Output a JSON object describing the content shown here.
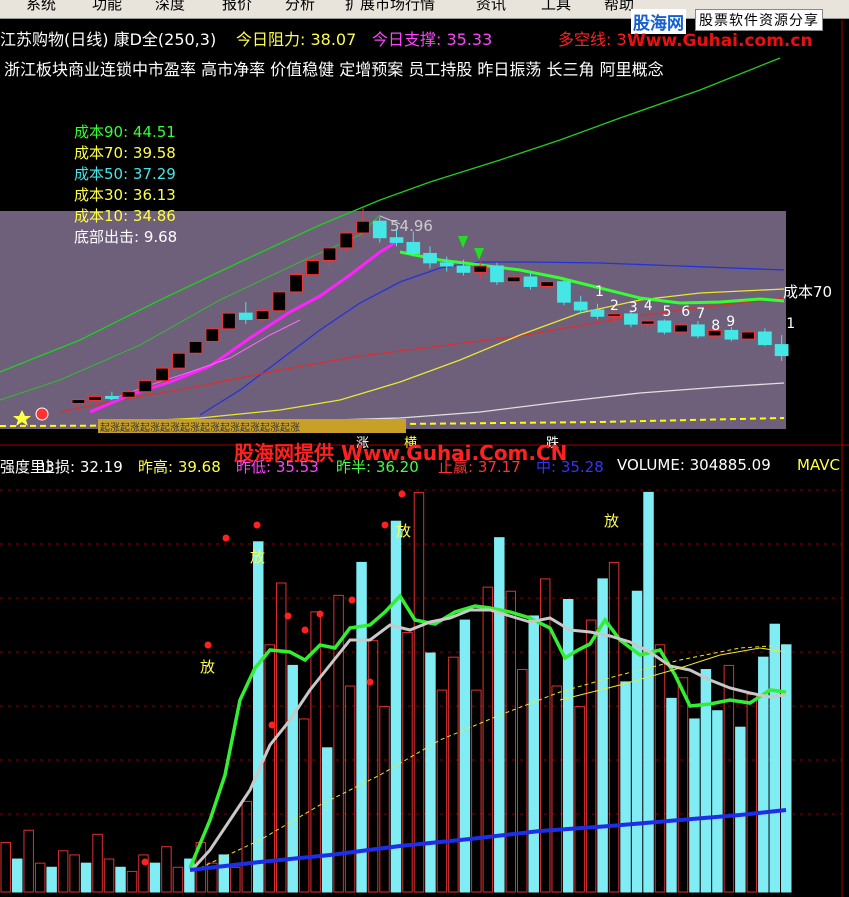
{
  "menu": [
    "系统",
    "功能",
    "深度",
    "报价",
    "分析",
    "扩展市场行情",
    "资讯",
    "工具",
    "帮助"
  ],
  "watermark": {
    "brand": "股海网",
    "tag": "股票软件资源分享",
    "url": "Www.Guhai.com.cn",
    "center": "股海网提供 Www.Guhai.Com.CN"
  },
  "title": {
    "name": "江苏购物(日线) 康D全(250,3)",
    "resistance": "今日阻力: 38.07",
    "support": "今日支撑: 35.33",
    "trend": "多空线: 3"
  },
  "concepts": "浙江板块商业连锁中市盈率 高市净率 价值稳健 定增预案 员工持股 昨日振荡 长三角 阿里概念",
  "cost_labels": [
    {
      "text": "成本90: 44.51",
      "color": "#33ff33"
    },
    {
      "text": "成本70: 39.58",
      "color": "#ffff44"
    },
    {
      "text": "成本50: 37.29",
      "color": "#44e6e6"
    },
    {
      "text": "成本30: 36.13",
      "color": "#ffff44"
    },
    {
      "text": "成本10: 34.86",
      "color": "#ffff44"
    },
    {
      "text": "底部出击: 9.68",
      "color": "#ffffff"
    }
  ],
  "upper_annotations": {
    "peak": "54.96",
    "cost70": "成本70",
    "numbers": [
      "1",
      "2",
      "3",
      "4",
      "5",
      "6",
      "7",
      "8",
      "9",
      "1"
    ],
    "volume_band": "起涨起涨起涨起涨起涨起涨起涨起涨起涨起涨",
    "bottom_marks": [
      "涨",
      "横",
      "跌"
    ]
  },
  "lower_header": [
    {
      "text": "强度里3",
      "color": "#ffffff"
    },
    {
      "text": "止损: 32.19",
      "color": "#ffffff"
    },
    {
      "text": "昨高: 39.68",
      "color": "#ffff44"
    },
    {
      "text": "昨低: 35.53",
      "color": "#ff44ff"
    },
    {
      "text": "昨半: 36.20",
      "color": "#44ff44"
    },
    {
      "text": "止赢: 37.17",
      "color": "#ff3333"
    },
    {
      "text": "中: 35.28",
      "color": "#3333ff"
    },
    {
      "text": "VOLUME: 304885.09",
      "color": "#ffffff"
    },
    {
      "text": "MAVC",
      "color": "#ffff44"
    }
  ],
  "fang_label": "放",
  "chart_data": [
    {
      "type": "candlestick",
      "title": "江苏购物(日线) 康D全(250,3)",
      "ylim": [
        0,
        60
      ],
      "candles": [
        {
          "o": 30.1,
          "h": 30.7,
          "l": 29.9,
          "c": 30.6
        },
        {
          "o": 30.5,
          "h": 31.2,
          "l": 30.3,
          "c": 31.0
        },
        {
          "o": 31.0,
          "h": 31.6,
          "l": 30.7,
          "c": 30.9
        },
        {
          "o": 30.9,
          "h": 31.8,
          "l": 30.8,
          "c": 31.6
        },
        {
          "o": 31.6,
          "h": 33.2,
          "l": 31.5,
          "c": 33.0
        },
        {
          "o": 33.0,
          "h": 34.9,
          "l": 32.9,
          "c": 34.6
        },
        {
          "o": 34.6,
          "h": 36.8,
          "l": 34.5,
          "c": 36.5
        },
        {
          "o": 36.5,
          "h": 38.2,
          "l": 36.3,
          "c": 38.0
        },
        {
          "o": 38.0,
          "h": 39.8,
          "l": 37.9,
          "c": 39.6
        },
        {
          "o": 39.6,
          "h": 41.8,
          "l": 39.5,
          "c": 41.6
        },
        {
          "o": 41.6,
          "h": 43.0,
          "l": 40.2,
          "c": 40.8
        },
        {
          "o": 40.8,
          "h": 42.2,
          "l": 40.5,
          "c": 41.9
        },
        {
          "o": 41.9,
          "h": 44.6,
          "l": 41.7,
          "c": 44.3
        },
        {
          "o": 44.3,
          "h": 46.8,
          "l": 44.1,
          "c": 46.5
        },
        {
          "o": 46.5,
          "h": 48.5,
          "l": 46.3,
          "c": 48.3
        },
        {
          "o": 48.3,
          "h": 50.4,
          "l": 47.2,
          "c": 49.9
        },
        {
          "o": 49.9,
          "h": 52.1,
          "l": 49.4,
          "c": 51.8
        },
        {
          "o": 51.8,
          "h": 54.96,
          "l": 51.2,
          "c": 53.3
        },
        {
          "o": 53.3,
          "h": 53.8,
          "l": 50.6,
          "c": 51.2
        },
        {
          "o": 51.2,
          "h": 52.4,
          "l": 50.1,
          "c": 50.6
        },
        {
          "o": 50.6,
          "h": 52.0,
          "l": 48.8,
          "c": 49.2
        },
        {
          "o": 49.2,
          "h": 50.1,
          "l": 47.3,
          "c": 48.0
        },
        {
          "o": 48.0,
          "h": 48.8,
          "l": 46.9,
          "c": 47.6
        },
        {
          "o": 47.6,
          "h": 48.4,
          "l": 46.4,
          "c": 46.8
        },
        {
          "o": 46.8,
          "h": 48.2,
          "l": 46.0,
          "c": 47.6
        },
        {
          "o": 47.6,
          "h": 48.0,
          "l": 45.2,
          "c": 45.6
        },
        {
          "o": 45.6,
          "h": 46.6,
          "l": 44.9,
          "c": 46.2
        },
        {
          "o": 46.2,
          "h": 46.8,
          "l": 44.6,
          "c": 45.0
        },
        {
          "o": 45.0,
          "h": 46.0,
          "l": 44.8,
          "c": 45.6
        },
        {
          "o": 45.6,
          "h": 45.9,
          "l": 42.6,
          "c": 43.0
        },
        {
          "o": 43.0,
          "h": 43.8,
          "l": 41.6,
          "c": 42.0
        },
        {
          "o": 42.0,
          "h": 42.8,
          "l": 40.8,
          "c": 41.2
        },
        {
          "o": 41.2,
          "h": 42.0,
          "l": 40.6,
          "c": 41.5
        },
        {
          "o": 41.5,
          "h": 41.8,
          "l": 39.8,
          "c": 40.2
        },
        {
          "o": 40.2,
          "h": 40.9,
          "l": 39.4,
          "c": 40.6
        },
        {
          "o": 40.6,
          "h": 40.8,
          "l": 38.9,
          "c": 39.2
        },
        {
          "o": 39.2,
          "h": 40.4,
          "l": 38.8,
          "c": 40.1
        },
        {
          "o": 40.1,
          "h": 40.6,
          "l": 38.4,
          "c": 38.7
        },
        {
          "o": 38.7,
          "h": 39.6,
          "l": 38.2,
          "c": 39.4
        },
        {
          "o": 39.4,
          "h": 39.8,
          "l": 38.0,
          "c": 38.3
        },
        {
          "o": 38.3,
          "h": 39.5,
          "l": 38.1,
          "c": 39.2
        },
        {
          "o": 39.2,
          "h": 39.68,
          "l": 37.4,
          "c": 37.6
        },
        {
          "o": 37.6,
          "h": 38.8,
          "l": 35.53,
          "c": 36.2
        }
      ]
    },
    {
      "type": "bar",
      "title": "VOLUME",
      "ylabel": "VOLUME",
      "ylim": [
        0,
        100
      ],
      "series": [
        {
          "name": "VOLUME",
          "values": [
            12,
            8,
            15,
            7,
            6,
            10,
            9,
            7,
            14,
            8,
            6,
            5,
            9,
            7,
            11,
            6,
            8,
            12,
            7,
            9,
            6,
            22,
            85,
            60,
            75,
            55,
            42,
            68,
            35,
            72,
            50,
            80,
            61,
            45,
            90,
            63,
            97,
            58,
            49,
            57,
            66,
            49,
            74,
            86,
            73,
            54,
            67,
            76,
            50,
            71,
            45,
            66,
            76,
            80,
            51,
            73,
            97,
            60,
            47,
            52,
            42,
            54,
            44,
            55,
            40,
            48,
            57,
            65,
            60
          ]
        }
      ]
    }
  ]
}
